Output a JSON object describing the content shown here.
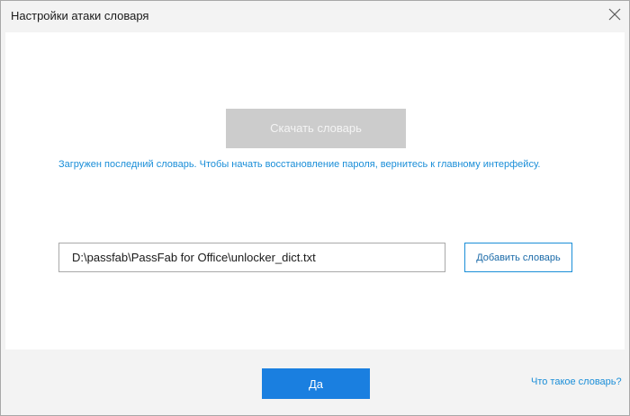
{
  "window": {
    "title": "Настройки атаки словаря",
    "close_icon": "close-icon"
  },
  "main": {
    "download_button_label": "Скачать словарь",
    "download_button_state": "disabled",
    "info_text": "Загружен последний словарь. Чтобы начать восстановление пароля, вернитесь к главному интерфейсу.",
    "dictionary_path_value": "D:\\passfab\\PassFab for Office\\unlocker_dict.txt",
    "add_dictionary_label": "Добавить словарь"
  },
  "footer": {
    "ok_label": "Да",
    "help_link": "Что такое словарь?"
  },
  "colors": {
    "accent": "#1a7fe0",
    "link": "#1a8ed8",
    "disabled_button": "#cccccc",
    "chrome_background": "#f3f3f3"
  }
}
